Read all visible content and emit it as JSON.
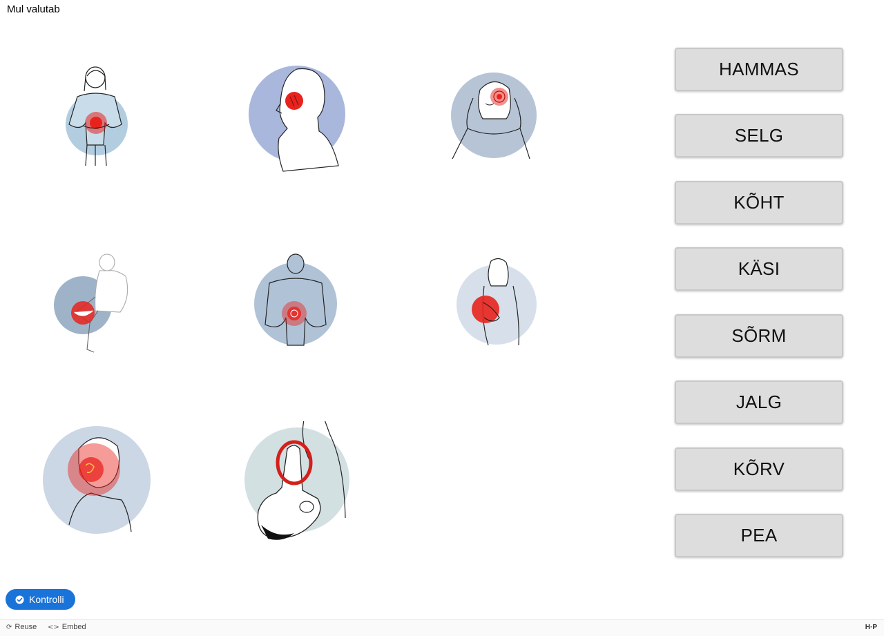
{
  "task": {
    "title": "Mul valutab"
  },
  "images": [
    {
      "name": "stomach-pain-image",
      "circle_color": "#b3cde0",
      "pain_area": "stomach"
    },
    {
      "name": "tooth-pain-image",
      "circle_color": "#a9b7dc",
      "pain_area": "jaw"
    },
    {
      "name": "head-pain-image",
      "circle_color": "#b6c4d6",
      "pain_area": "head"
    },
    {
      "name": "leg-pain-image",
      "circle_color": "#9fb3c8",
      "pain_area": "leg"
    },
    {
      "name": "back-pain-image",
      "circle_color": "#b0c2d6",
      "pain_area": "back"
    },
    {
      "name": "hand-pain-image",
      "circle_color": "#d7e0ea",
      "pain_area": "hand"
    },
    {
      "name": "ear-pain-image",
      "circle_color": "#cbd7e4",
      "pain_area": "ear"
    },
    {
      "name": "finger-pain-image",
      "circle_color": "#d3e0e2",
      "pain_area": "finger"
    }
  ],
  "words": [
    "HAMMAS",
    "SELG",
    "KÕHT",
    "KÄSI",
    "SÕRM",
    "JALG",
    "KÕRV",
    "PEA"
  ],
  "actions": {
    "check_label": "Kontrolli"
  },
  "footer": {
    "reuse_label": "Reuse",
    "embed_label": "Embed",
    "logo_text": "H·P"
  },
  "colors": {
    "accent": "#1a73d9",
    "pain_red": "#e8231d",
    "word_button_bg": "#dddddd"
  }
}
